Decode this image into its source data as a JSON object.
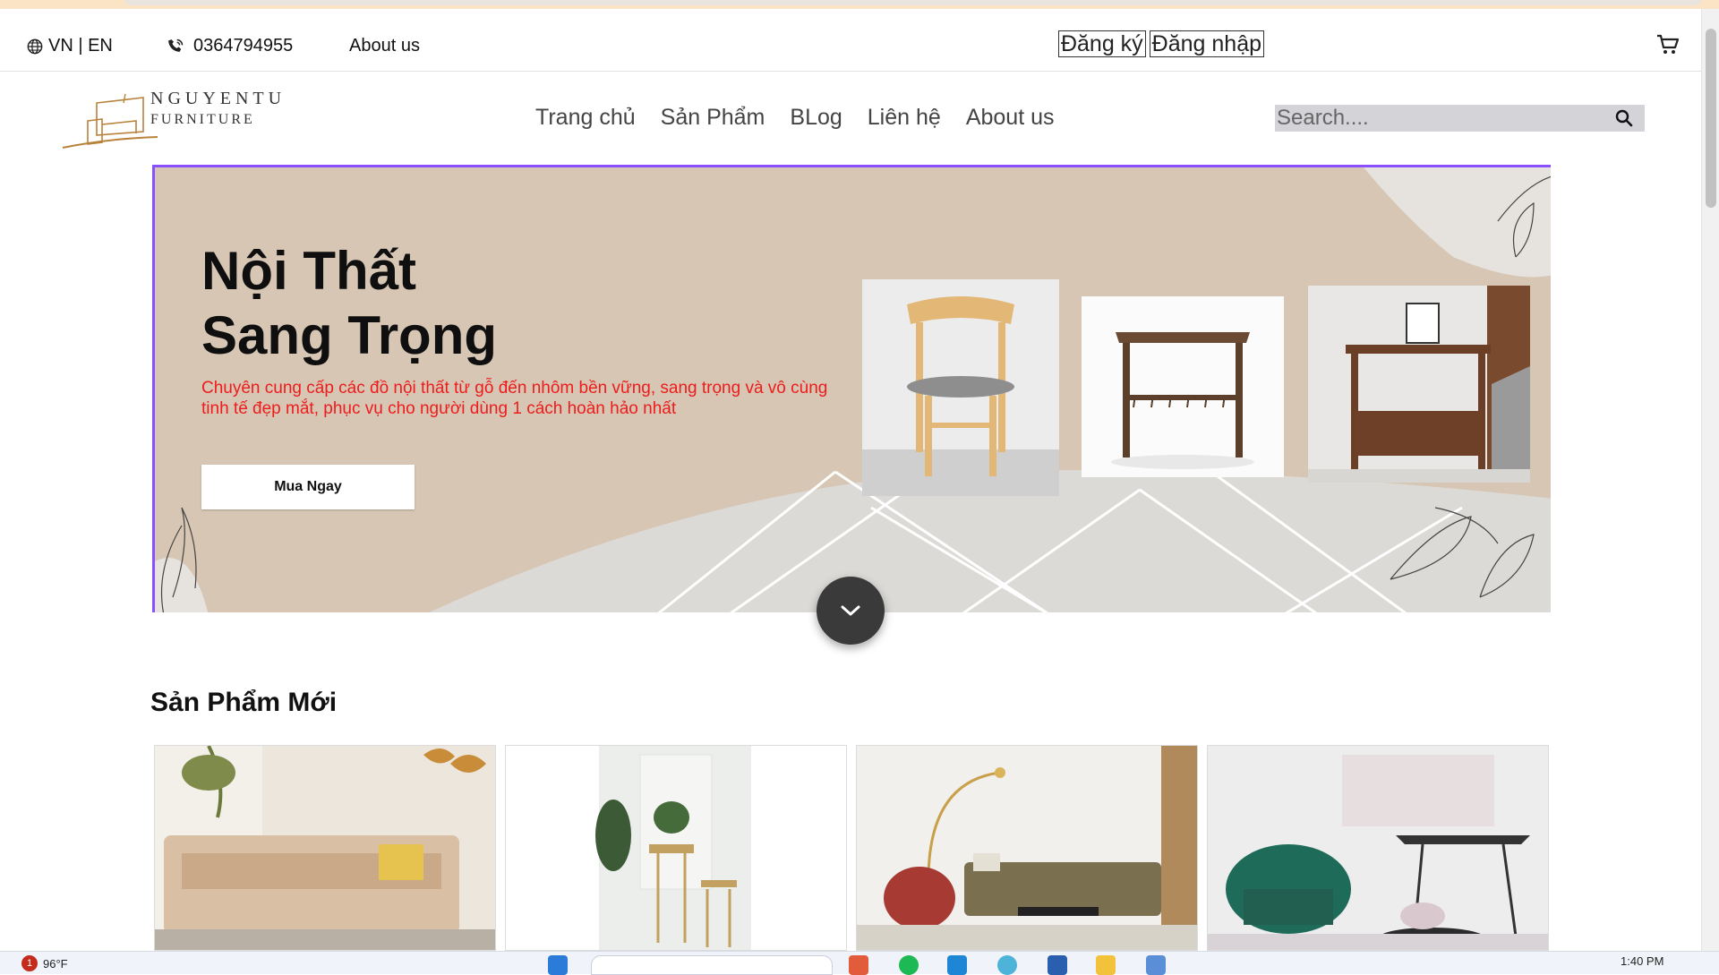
{
  "topbar": {
    "language": "VN | EN",
    "phone": "0364794955",
    "about": "About us",
    "register": "Đăng ký",
    "login": "Đăng nhập"
  },
  "logo": {
    "line1": "NGUYENTU",
    "line2": "FURNITURE"
  },
  "nav": {
    "items": [
      {
        "label": "Trang chủ"
      },
      {
        "label": "Sản Phẩm"
      },
      {
        "label": "BLog"
      },
      {
        "label": "Liên hệ"
      },
      {
        "label": "About us"
      }
    ]
  },
  "search": {
    "placeholder": "Search...."
  },
  "hero": {
    "title_line1": "Nội Thất",
    "title_line2": "Sang Trọng",
    "subtitle": "Chuyên cung cấp các đồ nội thất từ gỗ đến nhôm bền vững, sang trọng và vô cùng tinh tế đẹp mắt, phục vụ cho người dùng 1 cách hoàn hảo nhất",
    "button": "Mua Ngay"
  },
  "section": {
    "title": "Sản Phẩm Mới"
  },
  "taskbar": {
    "weather": "96°F",
    "notification_count": "1",
    "time": "1:40 PM"
  },
  "colors": {
    "accent_border": "#8a4fff",
    "hero_bg": "#d6c6b3",
    "subtitle": "#ee1c1c"
  }
}
